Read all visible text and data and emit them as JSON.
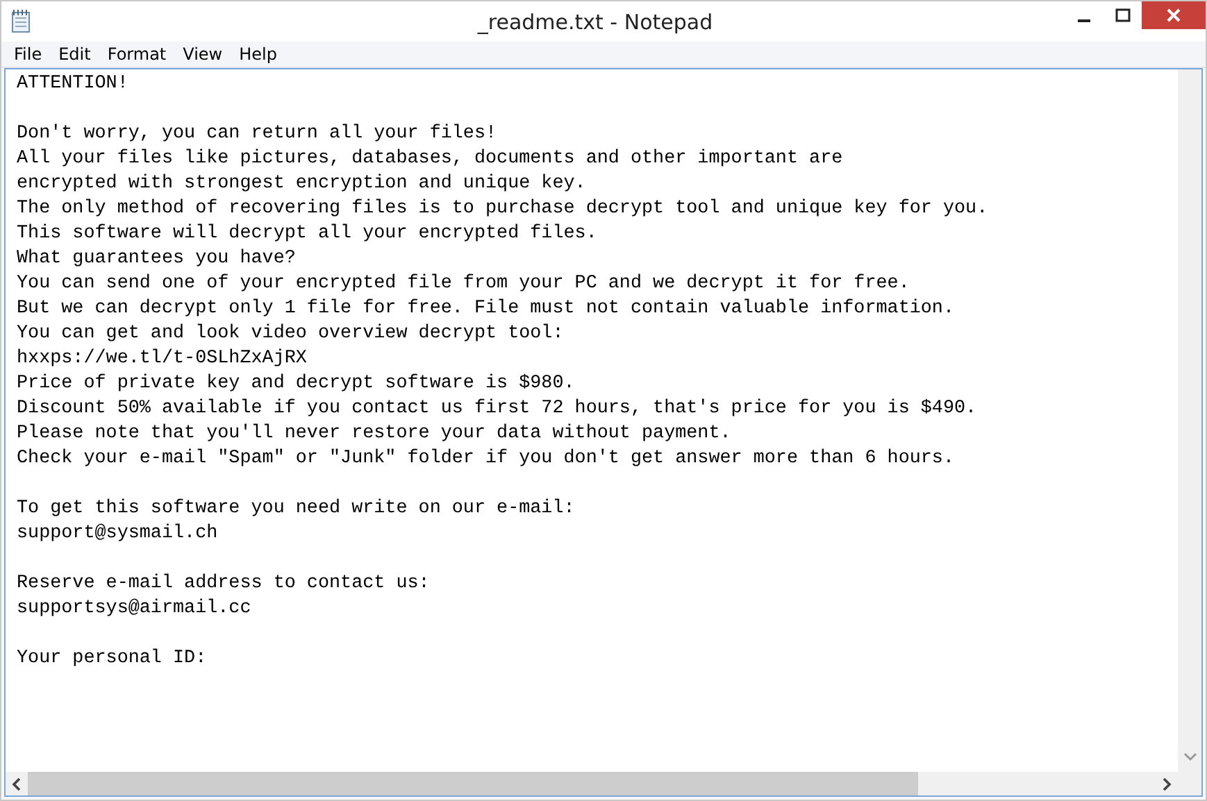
{
  "window": {
    "title": "_readme.txt - Notepad"
  },
  "menu": [
    "File",
    "Edit",
    "Format",
    "View",
    "Help"
  ],
  "document": {
    "paragraphs": [
      [
        "ATTENTION!"
      ],
      [
        "Don't worry, you can return all your files!",
        "All your files like pictures, databases, documents and other important are",
        "encrypted with strongest encryption and unique key.",
        "The only method of recovering files is to purchase decrypt tool and unique key for you.",
        "This software will decrypt all your encrypted files.",
        "What guarantees you have?",
        "You can send one of your encrypted file from your PC and we decrypt it for free.",
        "But we can decrypt only 1 file for free. File must not contain valuable information.",
        "You can get and look video overview decrypt tool:",
        "hxxps://we.tl/t-0SLhZxAjRX",
        "Price of private key and decrypt software is $980.",
        "Discount 50% available if you contact us first 72 hours, that's price for you is $490.",
        "Please note that you'll never restore your data without payment.",
        "Check your e-mail \"Spam\" or \"Junk\" folder if you don't get answer more than 6 hours."
      ],
      [
        "To get this software you need write on our e-mail:",
        "support@sysmail.ch"
      ],
      [
        "Reserve e-mail address to contact us:",
        "supportsys@airmail.cc"
      ],
      [
        "Your personal ID:"
      ]
    ]
  }
}
